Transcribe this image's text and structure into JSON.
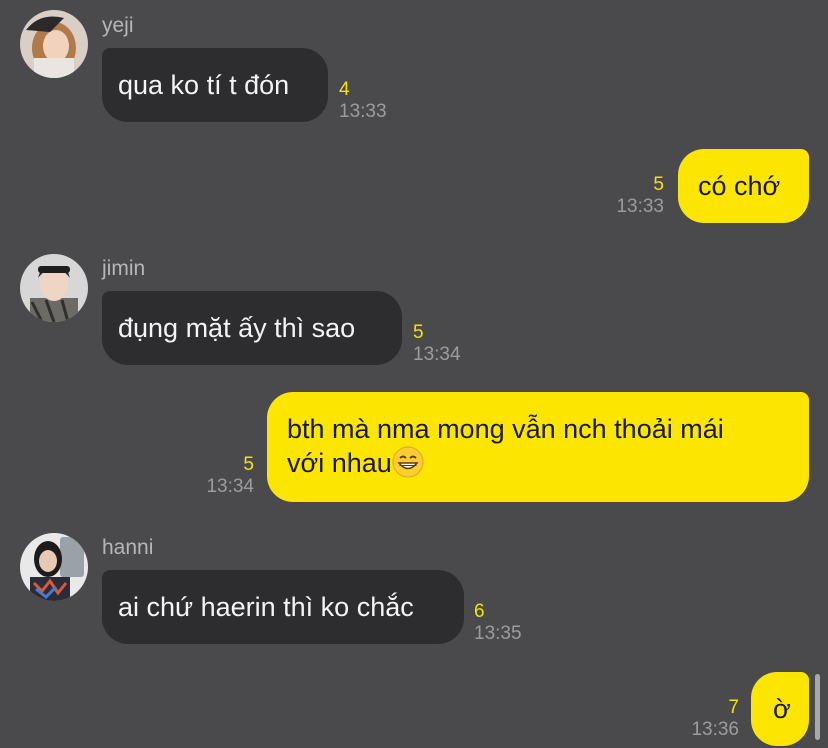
{
  "chat": {
    "messages": [
      {
        "sender": "yeji",
        "direction": "incoming",
        "text": "qua ko tí t đón",
        "unread": "4",
        "time": "13:33"
      },
      {
        "direction": "outgoing",
        "text": "có chớ",
        "unread": "5",
        "time": "13:33"
      },
      {
        "sender": "jimin",
        "direction": "incoming",
        "text": "đụng mặt ấy thì sao",
        "unread": "5",
        "time": "13:34"
      },
      {
        "direction": "outgoing",
        "text_line1": "bth mà nma mong vẫn nch thoải mái",
        "text_line2": "với nhau",
        "emoji": "grinning-face-with-smiling-eyes",
        "unread": "5",
        "time": "13:34"
      },
      {
        "sender": "hanni",
        "direction": "incoming",
        "text": "ai chứ haerin thì ko chắc",
        "unread": "6",
        "time": "13:35"
      },
      {
        "direction": "outgoing",
        "text": "ờ",
        "unread": "7",
        "time": "13:36"
      }
    ]
  },
  "colors": {
    "background": "#4a494c",
    "incoming_bubble": "#2d2d30",
    "outgoing_bubble": "#fce500",
    "unread_count": "#f5e400",
    "timestamp": "#9c9ca0"
  }
}
